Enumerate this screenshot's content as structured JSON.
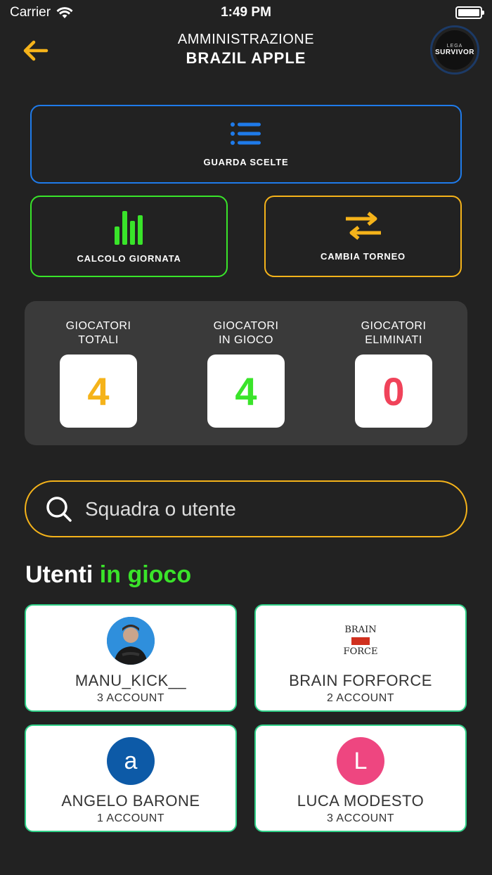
{
  "status_bar": {
    "carrier": "Carrier",
    "time": "1:49 PM"
  },
  "header": {
    "subtitle": "AMMINISTRAZIONE",
    "title": "BRAZIL APPLE",
    "logo_top": "LEGA",
    "logo_main": "SURVIVOR"
  },
  "actions": {
    "scelte_label": "GUARDA SCELTE",
    "calcolo_label": "CALCOLO GIORNATA",
    "cambia_label": "CAMBIA TORNEO"
  },
  "stats": [
    {
      "label_line1": "GIOCATORI",
      "label_line2": "TOTALI",
      "value": "4",
      "color": "#f5b31a"
    },
    {
      "label_line1": "GIOCATORI",
      "label_line2": "IN GIOCO",
      "value": "4",
      "color": "#3ae42a"
    },
    {
      "label_line1": "GIOCATORI",
      "label_line2": "ELIMINATI",
      "value": "0",
      "color": "#f0435a"
    }
  ],
  "search": {
    "placeholder": "Squadra o utente"
  },
  "section": {
    "title_white": "Utenti",
    "title_accent": "in gioco"
  },
  "users": [
    {
      "name": "MANU_KICK__",
      "accounts": "3 ACCOUNT",
      "avatar_type": "photo"
    },
    {
      "name": "BRAIN FORFORCE",
      "accounts": "2 ACCOUNT",
      "avatar_type": "logo",
      "logo_line1": "BRAIN",
      "logo_line2": "FOR",
      "logo_line3": "FORCE"
    },
    {
      "name": "ANGELO BARONE",
      "accounts": "1 ACCOUNT",
      "avatar_type": "initial",
      "initial": "a",
      "avatar_color": "#0d5aa7"
    },
    {
      "name": "LUCA MODESTO",
      "accounts": "3 ACCOUNT",
      "avatar_type": "initial",
      "initial": "L",
      "avatar_color": "#ee4680"
    }
  ],
  "colors": {
    "background": "#222222",
    "blue": "#1f7bea",
    "green": "#39e42a",
    "orange": "#f5b31a",
    "red": "#f0435a",
    "card_border": "#2fd088"
  }
}
